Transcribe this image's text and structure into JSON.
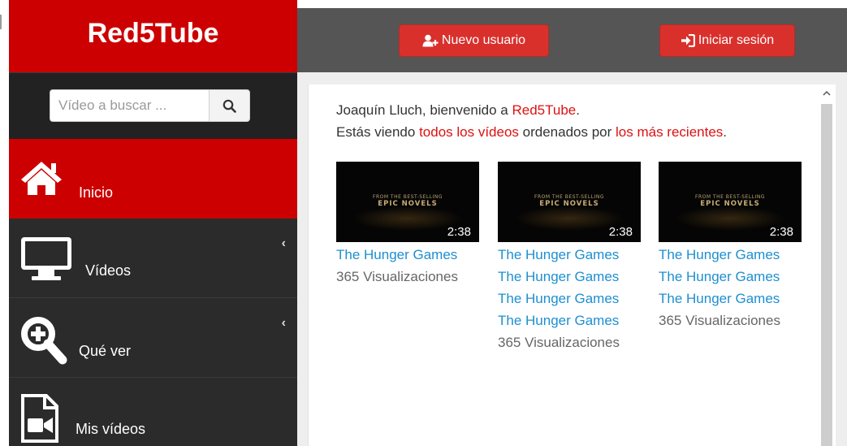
{
  "sidebar": {
    "brand": "Red5Tube",
    "search": {
      "placeholder": "Vídeo a buscar ...",
      "value": ""
    },
    "items": [
      {
        "label": "Inicio",
        "icon": "home-icon",
        "active": true
      },
      {
        "label": "Vídeos",
        "icon": "monitor-icon",
        "expandable": true
      },
      {
        "label": "Qué ver",
        "icon": "zoom-in-icon",
        "expandable": true
      },
      {
        "label": "Mis vídeos",
        "icon": "video-file-icon"
      }
    ]
  },
  "header": {
    "new_user_label": "Nuevo usuario",
    "login_label": "Iniciar sesión"
  },
  "greeting": {
    "user": "Joaquín Lluch",
    "welcome": ", bienvenido a ",
    "site": "Red5Tube",
    "period": ".",
    "viewing_prefix": "Estás viendo ",
    "viewing_filter": "todos los vídeos",
    "viewing_mid": " ordenados por ",
    "viewing_order": "los más recientes",
    "viewing_end": "."
  },
  "videos": [
    {
      "title": "The Hunger Games",
      "views": "365 Visualizaciones",
      "duration": "2:38",
      "thumb_line1": "FROM THE BEST-SELLING",
      "thumb_line2": "EPIC NOVELS"
    },
    {
      "title": "The Hunger Games The Hunger Games The Hunger Games The Hunger Games",
      "views": "365 Visualizaciones",
      "duration": "2:38",
      "thumb_line1": "FROM THE BEST-SELLING",
      "thumb_line2": "EPIC NOVELS"
    },
    {
      "title": "The Hunger Games The Hunger Games The Hunger Games",
      "views": "365 Visualizaciones",
      "duration": "2:38",
      "thumb_line1": "FROM THE BEST-SELLING",
      "thumb_line2": "EPIC NOVELS"
    }
  ],
  "colors": {
    "brand_red": "#cc0000",
    "button_red": "#d9302c",
    "link_blue": "#1d8fd0",
    "highlight_red": "#dd1111",
    "sidebar_dark": "#2b2b2b",
    "topbar_gray": "#555555"
  }
}
